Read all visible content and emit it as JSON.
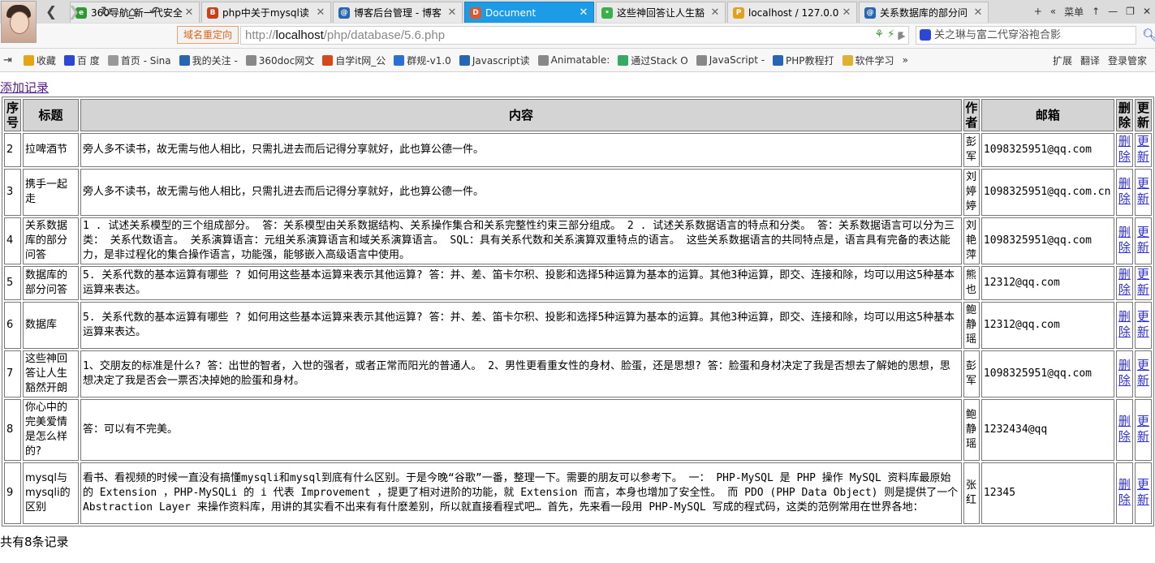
{
  "browser": {
    "tabs": [
      {
        "label": "360导航_新一代安全",
        "color": "#2b9a2f",
        "glyph": "e"
      },
      {
        "label": "php中关于mysql读",
        "color": "#c8401a",
        "glyph": "B"
      },
      {
        "label": "博客后台管理 - 博客",
        "color": "#2766b7",
        "glyph": "@"
      },
      {
        "label": "Document",
        "color": "#e0562a",
        "glyph": "D",
        "active": true
      },
      {
        "label": "这些神回答让人生豁",
        "color": "#3ab04b",
        "glyph": "•"
      },
      {
        "label": "localhost / 127.0.0",
        "color": "#e3a01c",
        "glyph": "P"
      },
      {
        "label": "关系数据库的部分问",
        "color": "#2766b7",
        "glyph": "@"
      }
    ],
    "tab_tools": [
      "+",
      "«",
      "菜单",
      "↑",
      "—",
      "❐",
      "✕"
    ],
    "redirect_label": "域名重定向",
    "url_prefix": "http://",
    "url_host": "localhost",
    "url_path": "/php/database/5.6.php",
    "search_text": "关之琳与富二代穿浴袍合影",
    "bookmarks": [
      "收藏",
      "百 度",
      "首页 - Sina",
      "我的关注 -",
      "360doc网文",
      "自学it网_公",
      "群规-v1.0",
      "Javascript读",
      "Animatable:",
      "通过Stack O",
      "JavaScript -",
      "PHP教程打",
      "软件学习",
      "»"
    ],
    "bookmarks_right": [
      "扩展",
      "翻译",
      "登录管家"
    ]
  },
  "page": {
    "add_link": "添加记录",
    "footer": "共有8条记录",
    "headers": {
      "id": "序号",
      "title": "标题",
      "content": "内容",
      "author": "作者",
      "email": "邮箱",
      "delete": "删除",
      "update": "更新"
    },
    "delete_label": "删除",
    "update_label": "更新",
    "rows": [
      {
        "id": "2",
        "title": "拉啤酒节",
        "content": "旁人多不读书，故无需与他人相比，只需扎进去而后记得分享就好，此也算公德一件。",
        "author": "彭军",
        "email": "1098325951@qq.com"
      },
      {
        "id": "3",
        "title": "携手一起走",
        "content": "旁人多不读书，故无需与他人相比，只需扎进去而后记得分享就好，此也算公德一件。",
        "author": "刘婷婷",
        "email": "1098325951@qq.com.cn"
      },
      {
        "id": "4",
        "title": "关系数据库的部分问答",
        "content": "1 . 试述关系模型的三个组成部分。 答：关系模型由关系数据结构、关系操作集合和关系完整性约束三部分组成。 2 . 试述关系数据语言的特点和分类。 答：关系数据语言可以分为三类： 关系代数语言。 关系演算语言：元组关系演算语言和域关系演算语言。 SQL：具有关系代数和关系演算双重特点的语言。 这些关系数据语言的共同特点是，语言具有完备的表达能力，是非过程化的集合操作语言，功能强，能够嵌入高级语言中使用。",
        "author": "刘艳萍",
        "email": "1098325951@qq.com"
      },
      {
        "id": "5",
        "title": "数据库的部分问答",
        "content": "5. 关系代数的基本运算有哪些 ? 如何用这些基本运算来表示其他运算? 答：并、差、笛卡尔积、投影和选择5种运算为基本的运算。其他3种运算，即交、连接和除，均可以用这5种基本运算来表达。",
        "author": "熊也",
        "email": "12312@qq.com"
      },
      {
        "id": "6",
        "title": "数据库",
        "content": "5. 关系代数的基本运算有哪些 ? 如何用这些基本运算来表示其他运算? 答：并、差、笛卡尔积、投影和选择5种运算为基本的运算。其他3种运算，即交、连接和除，均可以用这5种基本运算来表达。",
        "author": "鲍静瑶",
        "email": "12312@qq.com"
      },
      {
        "id": "7",
        "title": "这些神回答让人生豁然开朗",
        "content": "1、交朋友的标准是什么? 答：出世的智者，入世的强者，或者正常而阳光的普通人。 2、男性更看重女性的身材、脸蛋，还是思想? 答：脸蛋和身材决定了我是否想去了解她的思想，思想决定了我是否会一票否决掉她的脸蛋和身材。",
        "author": "彭军",
        "email": "1098325951@qq.com"
      },
      {
        "id": "8",
        "title": "你心中的完美爱情是怎么样的?",
        "content": "答：可以有不完美。",
        "author": "鲍静瑶",
        "email": "1232434@qq"
      },
      {
        "id": "9",
        "title": "mysql与mysqli的区别",
        "content": "看书、看视频的时候一直没有搞懂mysqli和mysql到底有什么区别。于是今晚“谷歌”一番，整理一下。需要的朋友可以参考下。 一： PHP-MySQL 是 PHP 操作 MySQL 资料库最原始的 Extension ，PHP-MySQLi 的 i 代表 Improvement ，提更了相对进阶的功能，就 Extension 而言，本身也增加了安全性。 而 PDO (PHP Data Object) 则是提供了一个 Abstraction Layer 来操作资料库，用讲的其实看不出来有有什麽差别，所以就直接看程式吧… 首先，先来看一段用 PHP-MySQL 写成的程式码，这类的范例常用在世界各地：",
        "author": "张红",
        "email": "12345"
      }
    ]
  }
}
